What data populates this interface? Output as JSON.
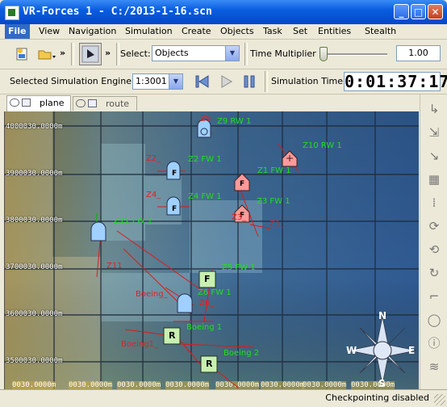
{
  "window": {
    "title": "VR-Forces 1 - C:/2013-1-16.scn",
    "minimize": "_",
    "maximize": "□",
    "close": "✕"
  },
  "menu": [
    "File",
    "View",
    "Navigation",
    "Simulation",
    "Create",
    "Objects",
    "Task",
    "Set",
    "Entities",
    "Stealth"
  ],
  "toolbar": {
    "overflow1": "»",
    "overflow2": "»",
    "select_label": "Select:",
    "select_value": "Objects",
    "time_multiplier_label": "Time Multiplier",
    "time_multiplier_value": "1.00",
    "time_multiplier_level": 0.0
  },
  "toolbar2": {
    "engine_label": "Selected Simulation Engine:",
    "engine_value": "1:3001",
    "sim_time_label": "Simulation Time",
    "sim_time_value": "0:01:37:17"
  },
  "tabs": [
    {
      "label": "plane",
      "active": true
    },
    {
      "label": "route",
      "active": false
    }
  ],
  "map": {
    "y_labels": [
      "4000030.0000m",
      "3900030.0000m",
      "3800030.0000m",
      "3700030.0000m",
      "3600030.0000m",
      "3500030.0000m"
    ],
    "x_labels": [
      "0030.0000m",
      "0030.0000m",
      "0030.0000m",
      "0030.0000m",
      "0030.0000m",
      "0030.0000m",
      "0030.0000m",
      "0030.0000m"
    ],
    "units": [
      {
        "label": "Z9 RW 1",
        "symbol": "",
        "kind": "rw"
      },
      {
        "label": "Z10 RW 1",
        "symbol": "",
        "kind": "rw-hostile"
      },
      {
        "label": "Z2 FW 1",
        "symbol": "F",
        "kind": "fw"
      },
      {
        "label": "Z1 FW 1",
        "symbol": "F",
        "kind": "fw-hostile"
      },
      {
        "label": "Z4 FW 1",
        "symbol": "F",
        "kind": "fw"
      },
      {
        "label": "Z3 FW 1",
        "symbol": "F",
        "kind": "fw-hostile"
      },
      {
        "label": "Z11 FW 1",
        "symbol": "",
        "kind": "fw"
      },
      {
        "label": "Z5 FW 1",
        "symbol": "F",
        "kind": "square"
      },
      {
        "label": "Z6 FW 1",
        "symbol": "",
        "kind": "fw"
      },
      {
        "label": "Boeing 1",
        "symbol": "R",
        "kind": "square"
      },
      {
        "label": "Boeing 2",
        "symbol": "R",
        "kind": "square"
      }
    ],
    "red_labels": [
      "Z9",
      "Z2_",
      "Z4_",
      "Z3_",
      "Z1_",
      "Z11",
      "Boeing_",
      "Z6_",
      "Boeing1_"
    ],
    "compass": {
      "n": "N",
      "s": "S",
      "e": "E",
      "w": "W"
    }
  },
  "sidebar_icons": [
    "route-icon",
    "waypoint-icon",
    "line-icon",
    "area-icon",
    "phase-line-icon",
    "orbit-icon",
    "orbit-icon",
    "rotate-icon",
    "step-icon",
    "circle-icon",
    "info-icon",
    "wave-icon"
  ],
  "status": "Checkpointing disabled",
  "colors": {
    "titlebar": "#0a5ee0",
    "friendly": "#9fd0ff",
    "hostile": "#ff9a9a",
    "label_green": "#22dd22",
    "label_red": "#dd2222"
  }
}
